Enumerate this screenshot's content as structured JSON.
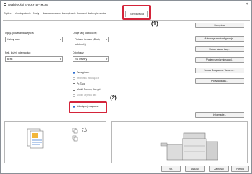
{
  "window": {
    "title": "Właściwości SHARP BP-xxxxx",
    "close": "✕"
  },
  "tabs": [
    {
      "label": "Ogólne"
    },
    {
      "label": "Udostępnianie"
    },
    {
      "label": "Porty"
    },
    {
      "label": "Zaawansowane"
    },
    {
      "label": "Zarządzanie Kolorami"
    },
    {
      "label": "Zabezpieczenia"
    },
    {
      "label": "Konfiguracja"
    }
  ],
  "callouts": {
    "one": "(1)",
    "two": "(2)"
  },
  "left": {
    "input_tray_label": "Opcja podawania wejścia:",
    "input_tray_value": "Cztery tace",
    "output_tray_label": "Fed. dużej pojemności:",
    "output_tray_value": "Brak"
  },
  "middle": {
    "output_label": "Opcje tacy odbiorczej:",
    "output_value": "Finiszer broszur (Duży odbiornik)",
    "punch_label": "Dziurkacz:",
    "punch_value": "2/4 Otwory",
    "checkboxes": [
      {
        "label": "Taca główna",
        "checked": true,
        "disabled": false
      },
      {
        "label": "Jednostka składająca",
        "checked": false,
        "disabled": true
      },
      {
        "label": "Pr. Taca",
        "checked": false,
        "disabled": false
      },
      {
        "label": "Moduł Ochrony Danych",
        "checked": false,
        "disabled": false
      },
      {
        "label": "Moduł czytnika kart",
        "checked": false,
        "disabled": true
      },
      {
        "label": "Udostępnij zszywacz",
        "checked": true,
        "disabled": false
      }
    ]
  },
  "right_buttons": [
    "Domyślne",
    "Automatyczna konfiguracja...",
    "Ustaw status tacy...",
    "Papier rozmiar niestand...",
    "Ustaw Dołączanie Tandem...",
    "Polityka druku...",
    "Informacje..."
  ],
  "bottom_buttons": {
    "ok": "OK",
    "cancel": "Anuluj",
    "apply": "Zastosuj",
    "help": "Pomoc"
  }
}
